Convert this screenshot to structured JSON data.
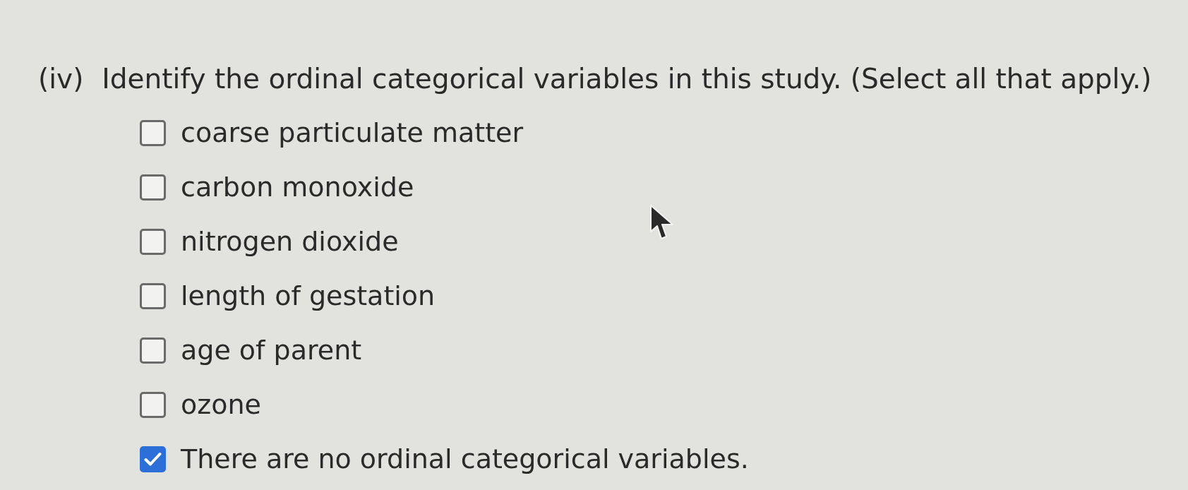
{
  "question": {
    "number": "(iv)",
    "prompt": "Identify the ordinal categorical variables in this study. (Select all that apply.)"
  },
  "options": [
    {
      "label": "coarse particulate matter",
      "checked": false
    },
    {
      "label": "carbon monoxide",
      "checked": false
    },
    {
      "label": "nitrogen dioxide",
      "checked": false
    },
    {
      "label": "length of gestation",
      "checked": false
    },
    {
      "label": "age of parent",
      "checked": false
    },
    {
      "label": "ozone",
      "checked": false
    },
    {
      "label": "There are no ordinal categorical variables.",
      "checked": true
    }
  ]
}
